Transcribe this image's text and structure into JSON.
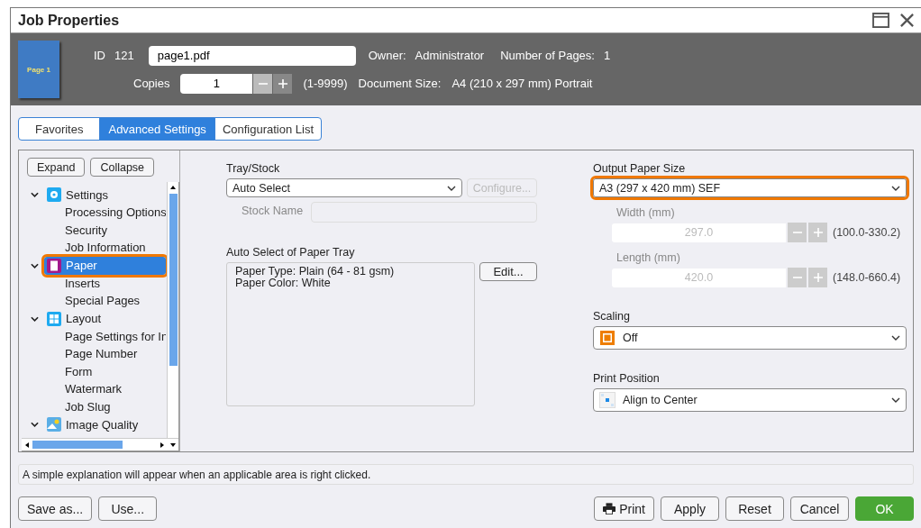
{
  "window": {
    "title": "Job Properties"
  },
  "header": {
    "thumbnail_label": "Page 1",
    "id_label": "ID",
    "id_value": "121",
    "file_name": "page1.pdf",
    "owner_label": "Owner:",
    "owner": "Administrator",
    "pages_label": "Number of Pages:",
    "pages": "1",
    "copies_label": "Copies",
    "copies": "1",
    "copies_range": "(1-9999)",
    "doc_size_label": "Document Size:",
    "doc_size": "A4 (210 x 297 mm) Portrait"
  },
  "tabs": [
    {
      "label": "Favorites",
      "selected": false
    },
    {
      "label": "Advanced Settings",
      "selected": true
    },
    {
      "label": "Configuration List",
      "selected": false
    }
  ],
  "tree": {
    "expand": "Expand",
    "collapse": "Collapse",
    "items": [
      {
        "label": "Settings",
        "expanded": true,
        "selected": false,
        "highlighted": false,
        "children": [
          {
            "label": "Processing Options"
          },
          {
            "label": "Security"
          },
          {
            "label": "Job Information"
          }
        ]
      },
      {
        "label": "Paper",
        "expanded": true,
        "selected": true,
        "highlighted": true,
        "children": [
          {
            "label": "Inserts"
          },
          {
            "label": "Special Pages"
          }
        ]
      },
      {
        "label": "Layout",
        "expanded": true,
        "selected": false,
        "highlighted": false,
        "children": [
          {
            "label": "Page Settings for In"
          },
          {
            "label": "Page Number"
          },
          {
            "label": "Form"
          },
          {
            "label": "Watermark"
          },
          {
            "label": "Job Slug"
          }
        ]
      },
      {
        "label": "Image Quality",
        "expanded": true,
        "selected": false,
        "highlighted": false
      }
    ]
  },
  "tray": {
    "label": "Tray/Stock",
    "value": "Auto Select",
    "configure": "Configure...",
    "configure_disabled": true,
    "stock_label": "Stock Name"
  },
  "auto_select": {
    "label": "Auto Select of Paper Tray",
    "lines": [
      "Paper Type: Plain (64 - 81 gsm)",
      "Paper Color: White"
    ],
    "edit": "Edit..."
  },
  "output": {
    "label": "Output Paper Size",
    "value": "A3 (297 x 420 mm) SEF",
    "highlighted": true,
    "dims": [
      {
        "label": "Width (mm)",
        "value": "297.0",
        "range": "(100.0-330.2)",
        "disabled": true
      },
      {
        "label": "Length (mm)",
        "value": "420.0",
        "range": "(148.0-660.4)",
        "disabled": true
      }
    ]
  },
  "scaling": {
    "label": "Scaling",
    "value": "Off"
  },
  "print_position": {
    "label": "Print Position",
    "value": "Align to Center"
  },
  "hint": "A simple explanation will appear when an applicable area is right clicked.",
  "left_buttons": [
    "Save as...",
    "Use..."
  ],
  "right_buttons": [
    {
      "label": "Print",
      "kind": "print"
    },
    {
      "label": "Apply",
      "kind": "plain"
    },
    {
      "label": "Reset",
      "kind": "plain"
    },
    {
      "label": "Cancel",
      "kind": "plain"
    },
    {
      "label": "OK",
      "kind": "primary"
    }
  ]
}
